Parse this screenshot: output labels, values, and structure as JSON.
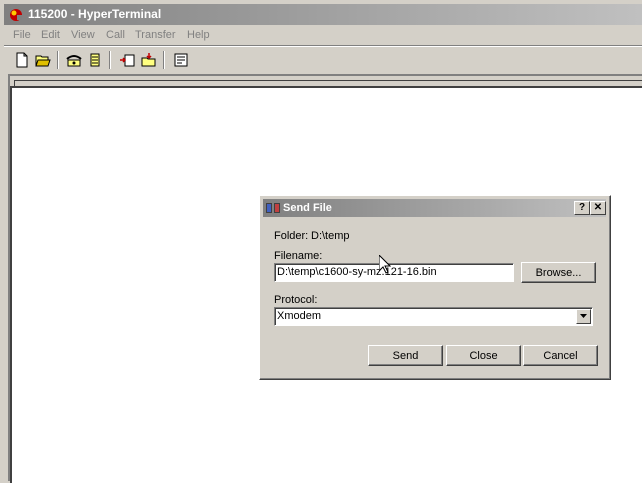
{
  "window": {
    "title": "115200 - HyperTerminal",
    "icon": "hyperterminal-icon"
  },
  "menu": [
    "File",
    "Edit",
    "View",
    "Call",
    "Transfer",
    "Help"
  ],
  "toolbar": {
    "buttons": [
      "new-icon",
      "open-icon",
      "connect-icon",
      "disconnect-icon",
      "send-icon",
      "receive-icon",
      "properties-icon"
    ]
  },
  "dialog": {
    "title": "Send File",
    "help_label": "?",
    "close_label": "✕",
    "folder_label": "Folder:",
    "folder_value": "D:\\temp",
    "filename_label": "Filename:",
    "filename_value": "D:\\temp\\c1600-sy-mz.121-16.bin",
    "browse_label": "Browse...",
    "protocol_label": "Protocol:",
    "protocol_value": "Xmodem",
    "send_label": "Send",
    "close_button_label": "Close",
    "cancel_label": "Cancel"
  }
}
